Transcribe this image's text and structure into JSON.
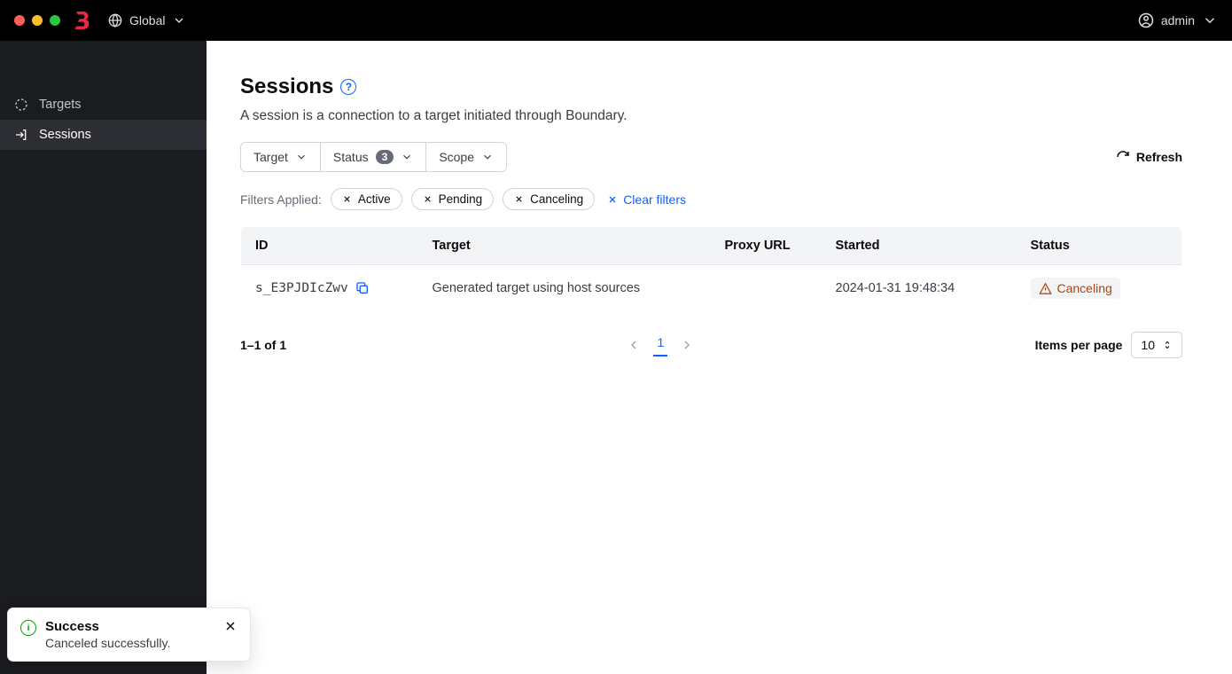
{
  "header": {
    "scope_label": "Global",
    "user_label": "admin"
  },
  "sidebar": {
    "items": [
      {
        "label": "Targets"
      },
      {
        "label": "Sessions"
      }
    ]
  },
  "page": {
    "title": "Sessions",
    "description": "A session is a connection to a target initiated through Boundary."
  },
  "filters": {
    "target_label": "Target",
    "status_label": "Status",
    "status_count": "3",
    "scope_label": "Scope",
    "refresh_label": "Refresh",
    "applied_label": "Filters Applied:",
    "chips": [
      {
        "label": "Active"
      },
      {
        "label": "Pending"
      },
      {
        "label": "Canceling"
      }
    ],
    "clear_label": "Clear filters"
  },
  "table": {
    "headers": {
      "id": "ID",
      "target": "Target",
      "proxy": "Proxy URL",
      "started": "Started",
      "status": "Status"
    },
    "rows": [
      {
        "id": "s_E3PJDIcZwv",
        "target": "Generated target using host sources",
        "proxy": "",
        "started": "2024-01-31 19:48:34",
        "status": "Canceling"
      }
    ]
  },
  "pagination": {
    "summary": "1–1 of 1",
    "current_page": "1",
    "per_page_label": "Items per page",
    "per_page_value": "10"
  },
  "toast": {
    "title": "Success",
    "message": "Canceled successfully."
  }
}
